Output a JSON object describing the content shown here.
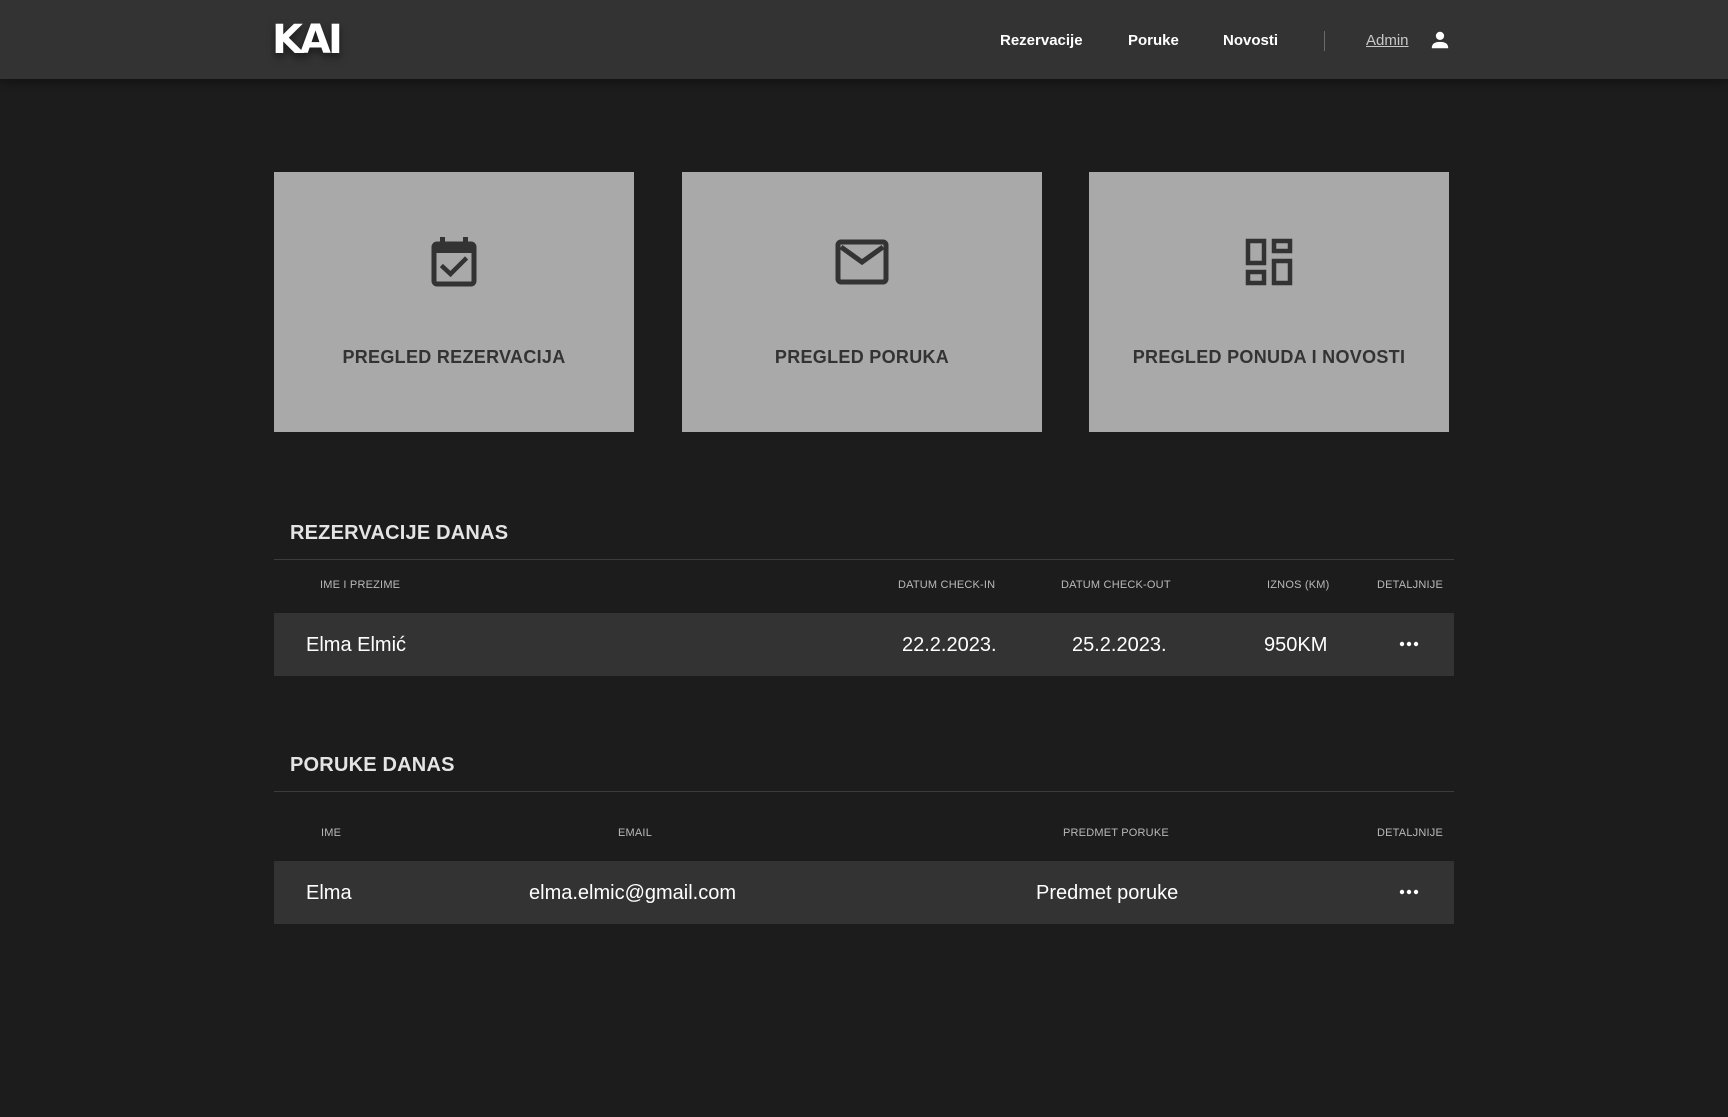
{
  "header": {
    "logo_text": "KAI",
    "nav": {
      "reservations": "Rezervacije",
      "messages": "Poruke",
      "news": "Novosti"
    },
    "admin_label": "Admin",
    "user_icon": "person-icon"
  },
  "cards": [
    {
      "label": "PREGLED REZERVACIJA",
      "icon": "calendar-check-icon"
    },
    {
      "label": "PREGLED PORUKA",
      "icon": "mail-icon"
    },
    {
      "label": "PREGLED PONUDA I NOVOSTI",
      "icon": "dashboard-icon"
    }
  ],
  "reservations_today": {
    "title": "REZERVACIJE DANAS",
    "columns": {
      "name": "IME I PREZIME",
      "check_in": "DATUM CHECK-IN",
      "check_out": "DATUM CHECK-OUT",
      "amount": "IZNOS (KM)",
      "details": "DETALJNIJE"
    },
    "rows": [
      {
        "name": "Elma Elmić",
        "check_in": "22.2.2023.",
        "check_out": "25.2.2023.",
        "amount": "950KM"
      }
    ]
  },
  "messages_today": {
    "title": "PORUKE DANAS",
    "columns": {
      "name": "IME",
      "email": "EMAIL",
      "subject": "PREDMET PORUKE",
      "details": "DETALJNIJE"
    },
    "rows": [
      {
        "name": "Elma",
        "email": "elma.elmic@gmail.com",
        "subject": "Predmet poruke"
      }
    ]
  },
  "colors": {
    "background": "#1c1c1c",
    "header": "#333333",
    "card": "#a9a9a9",
    "card_text": "#333333",
    "row": "#333333"
  }
}
